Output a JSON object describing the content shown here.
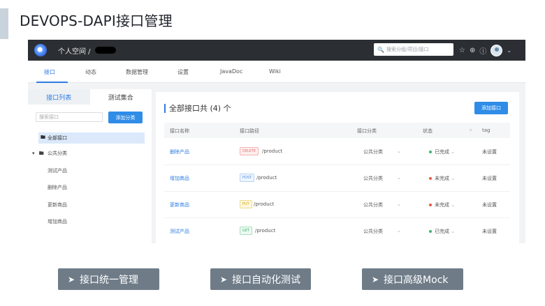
{
  "slide": {
    "title": "DEVOPS-DAPI接口管理",
    "features": [
      "接口统一管理",
      "接口自动化测试",
      "接口高级Mock"
    ]
  },
  "topbar": {
    "space_label": "个人空间 /",
    "search_placeholder": "搜索分组/项目/接口",
    "icons": [
      "star-icon",
      "plus-circle-icon",
      "help-icon",
      "avatar",
      "chevron-down-icon"
    ]
  },
  "nav": {
    "tabs": [
      "接口",
      "动态",
      "数据管理",
      "设置",
      "JavaDoc",
      "Wiki"
    ],
    "active": "接口"
  },
  "sidebar": {
    "tabs": [
      "接口列表",
      "测试集合"
    ],
    "search_placeholder": "搜索接口",
    "add_category": "添加分类",
    "all_interfaces": "全部接口",
    "group": "公共分类",
    "children": [
      "测试产品",
      "删除产品",
      "更新商品",
      "增加商品"
    ]
  },
  "main": {
    "title": "全部接口共 (4) 个",
    "add_button": "添加接口",
    "columns": [
      "接口名称",
      "接口路径",
      "接口分类",
      "状态",
      "tag"
    ],
    "rows": [
      {
        "name": "删除产品",
        "method": "DELETE",
        "path": "/product",
        "category": "公共分类",
        "status": "已完成",
        "tag": "未设置"
      },
      {
        "name": "增加商品",
        "method": "POST",
        "path": "/product",
        "category": "公共分类",
        "status": "未完成",
        "tag": "未设置"
      },
      {
        "name": "更新商品",
        "method": "PUT",
        "path": "/product",
        "category": "公共分类",
        "status": "未完成",
        "tag": "未设置"
      },
      {
        "name": "测试产品",
        "method": "GET",
        "path": "/product",
        "category": "公共分类",
        "status": "已完成",
        "tag": "未设置"
      }
    ]
  },
  "colors": {
    "accent": "#2f7de1",
    "done": "#3cb371",
    "todo": "#e55a3c",
    "delete": "#e57373",
    "post": "#4a90e2",
    "put": "#e6b800",
    "get": "#3cb371"
  }
}
